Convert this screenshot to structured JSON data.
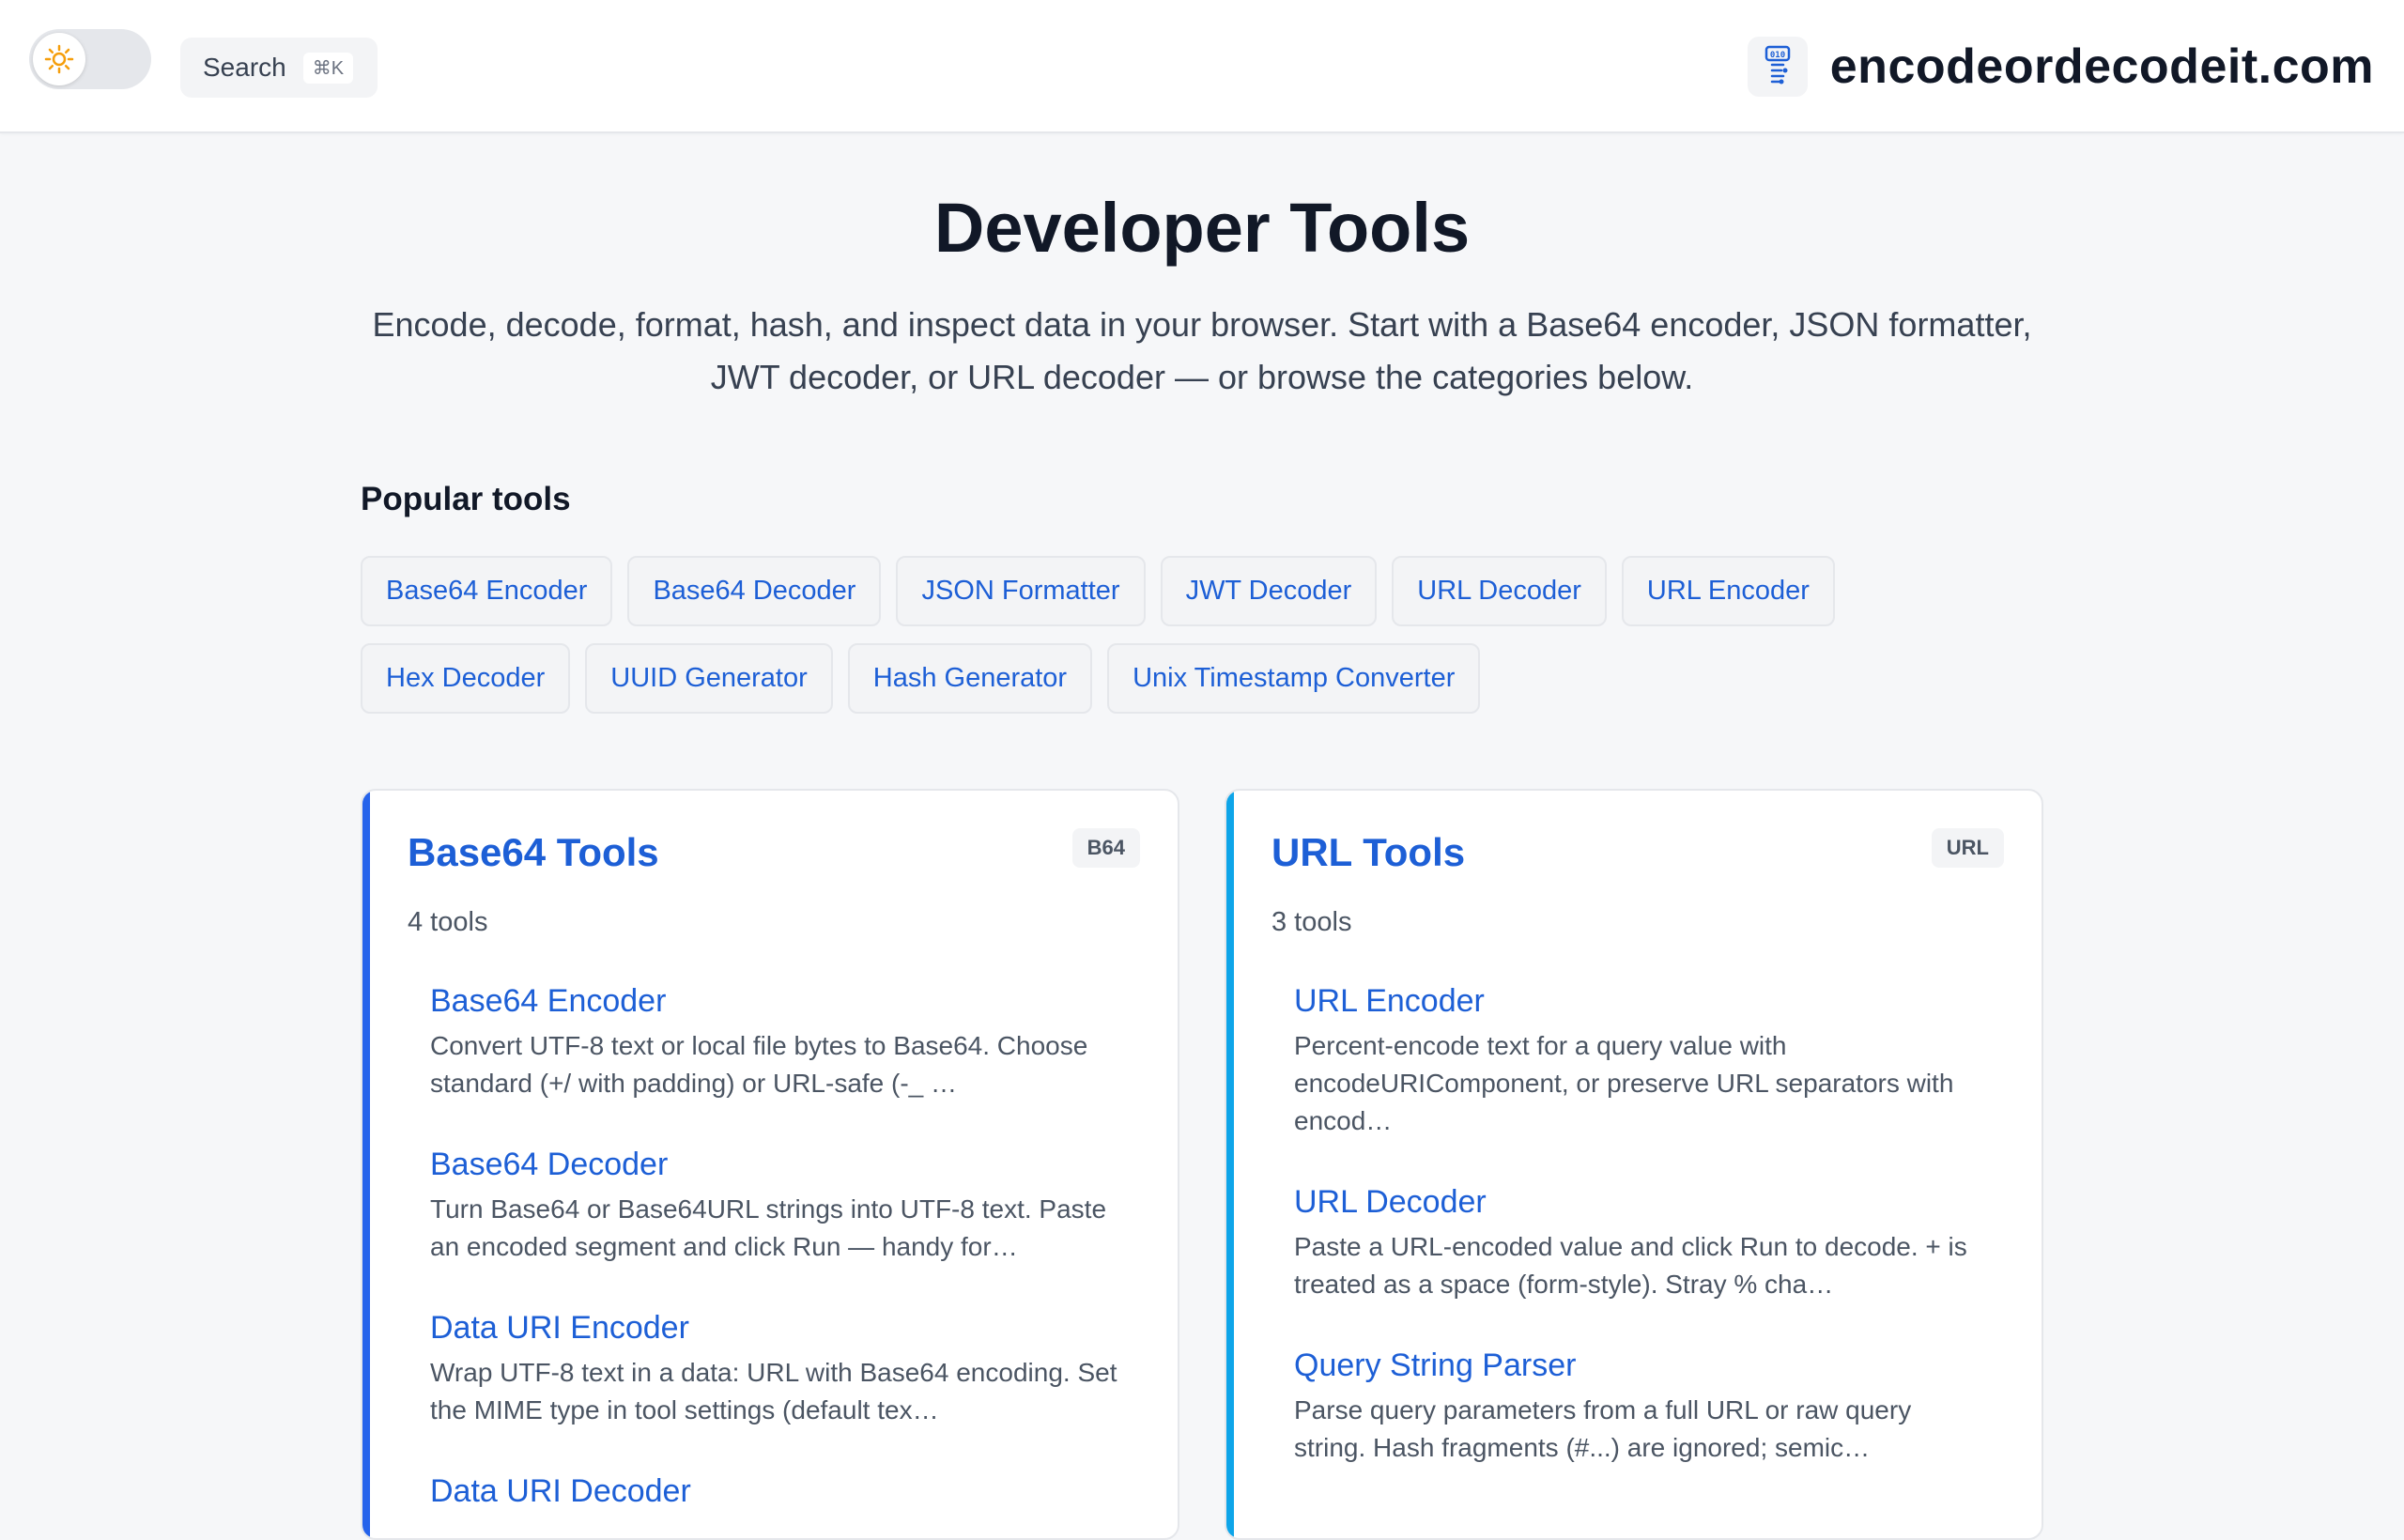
{
  "header": {
    "search_label": "Search",
    "search_shortcut": "⌘K",
    "site_name": "encodeordecodeit.com",
    "theme_icon": "sun-icon",
    "logo_icon": "binary-code-icon"
  },
  "hero": {
    "title": "Developer Tools",
    "subtitle": "Encode, decode, format, hash, and inspect data in your browser. Start with a Base64 encoder, JSON formatter, JWT decoder, or URL decoder — or browse the categories below."
  },
  "popular": {
    "title": "Popular tools",
    "items": [
      "Base64 Encoder",
      "Base64 Decoder",
      "JSON Formatter",
      "JWT Decoder",
      "URL Decoder",
      "URL Encoder",
      "Hex Decoder",
      "UUID Generator",
      "Hash Generator",
      "Unix Timestamp Converter"
    ]
  },
  "categories": [
    {
      "title": "Base64 Tools",
      "badge": "B64",
      "count": "4 tools",
      "accent": "#2563eb",
      "tools": [
        {
          "name": "Base64 Encoder",
          "desc": "Convert UTF-8 text or local file bytes to Base64. Choose standard (+/ with padding) or URL-safe (-_ …"
        },
        {
          "name": "Base64 Decoder",
          "desc": "Turn Base64 or Base64URL strings into UTF-8 text. Paste an encoded segment and click Run — handy for…"
        },
        {
          "name": "Data URI Encoder",
          "desc": "Wrap UTF-8 text in a data: URL with Base64 encoding. Set the MIME type in tool settings (default tex…"
        },
        {
          "name": "Data URI Decoder",
          "desc": ""
        }
      ]
    },
    {
      "title": "URL Tools",
      "badge": "URL",
      "count": "3 tools",
      "accent": "#0ea5e9",
      "tools": [
        {
          "name": "URL Encoder",
          "desc": "Percent-encode text for a query value with encodeURIComponent, or preserve URL separators with encod…"
        },
        {
          "name": "URL Decoder",
          "desc": "Paste a URL-encoded value and click Run to decode. + is treated as a space (form-style). Stray % cha…"
        },
        {
          "name": "Query String Parser",
          "desc": "Parse query parameters from a full URL or raw query string. Hash fragments (#...) are ignored; semic…"
        }
      ]
    }
  ]
}
